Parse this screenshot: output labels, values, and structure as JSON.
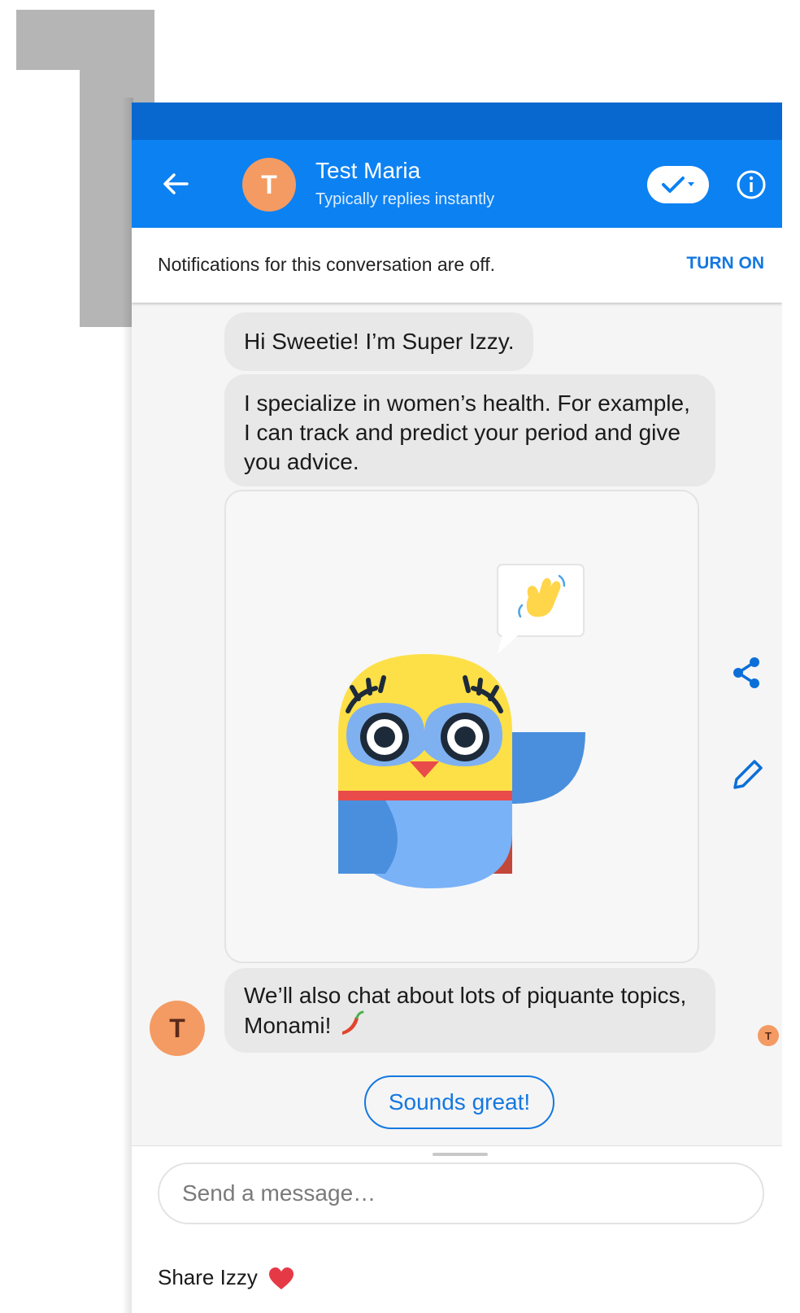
{
  "header": {
    "avatar_letter": "T",
    "contact_name": "Test Maria",
    "contact_status": "Typically replies instantly",
    "icons": [
      "back-arrow-icon",
      "check-dropdown-icon",
      "info-icon"
    ]
  },
  "notification": {
    "text": "Notifications for this conversation are off.",
    "action_label": "TURN ON"
  },
  "messages": [
    {
      "text": "Hi Sweetie! I’m Super Izzy."
    },
    {
      "text": "I specialize in women’s health. For example, I can track and predict your period and give you advice."
    },
    {
      "text": "We’ll also chat about lots of piquante topics, Monami!"
    }
  ],
  "card": {
    "illustration": "owl-superhero",
    "speech_emoji": "waving-hand",
    "side_actions": [
      "share-icon",
      "edit-icon"
    ]
  },
  "bottom": {
    "avatar_letter": "T",
    "receipt_letter": "T"
  },
  "quick_reply": "Sounds great!",
  "composer": {
    "placeholder": "Send a message…",
    "share_text": "Share Izzy"
  },
  "colors": {
    "header_blue": "#0c81f2",
    "status_blue": "#0868d0",
    "accent_blue": "#1478e0",
    "avatar_orange": "#f49b63",
    "bubble_gray": "#e8e8e8"
  }
}
